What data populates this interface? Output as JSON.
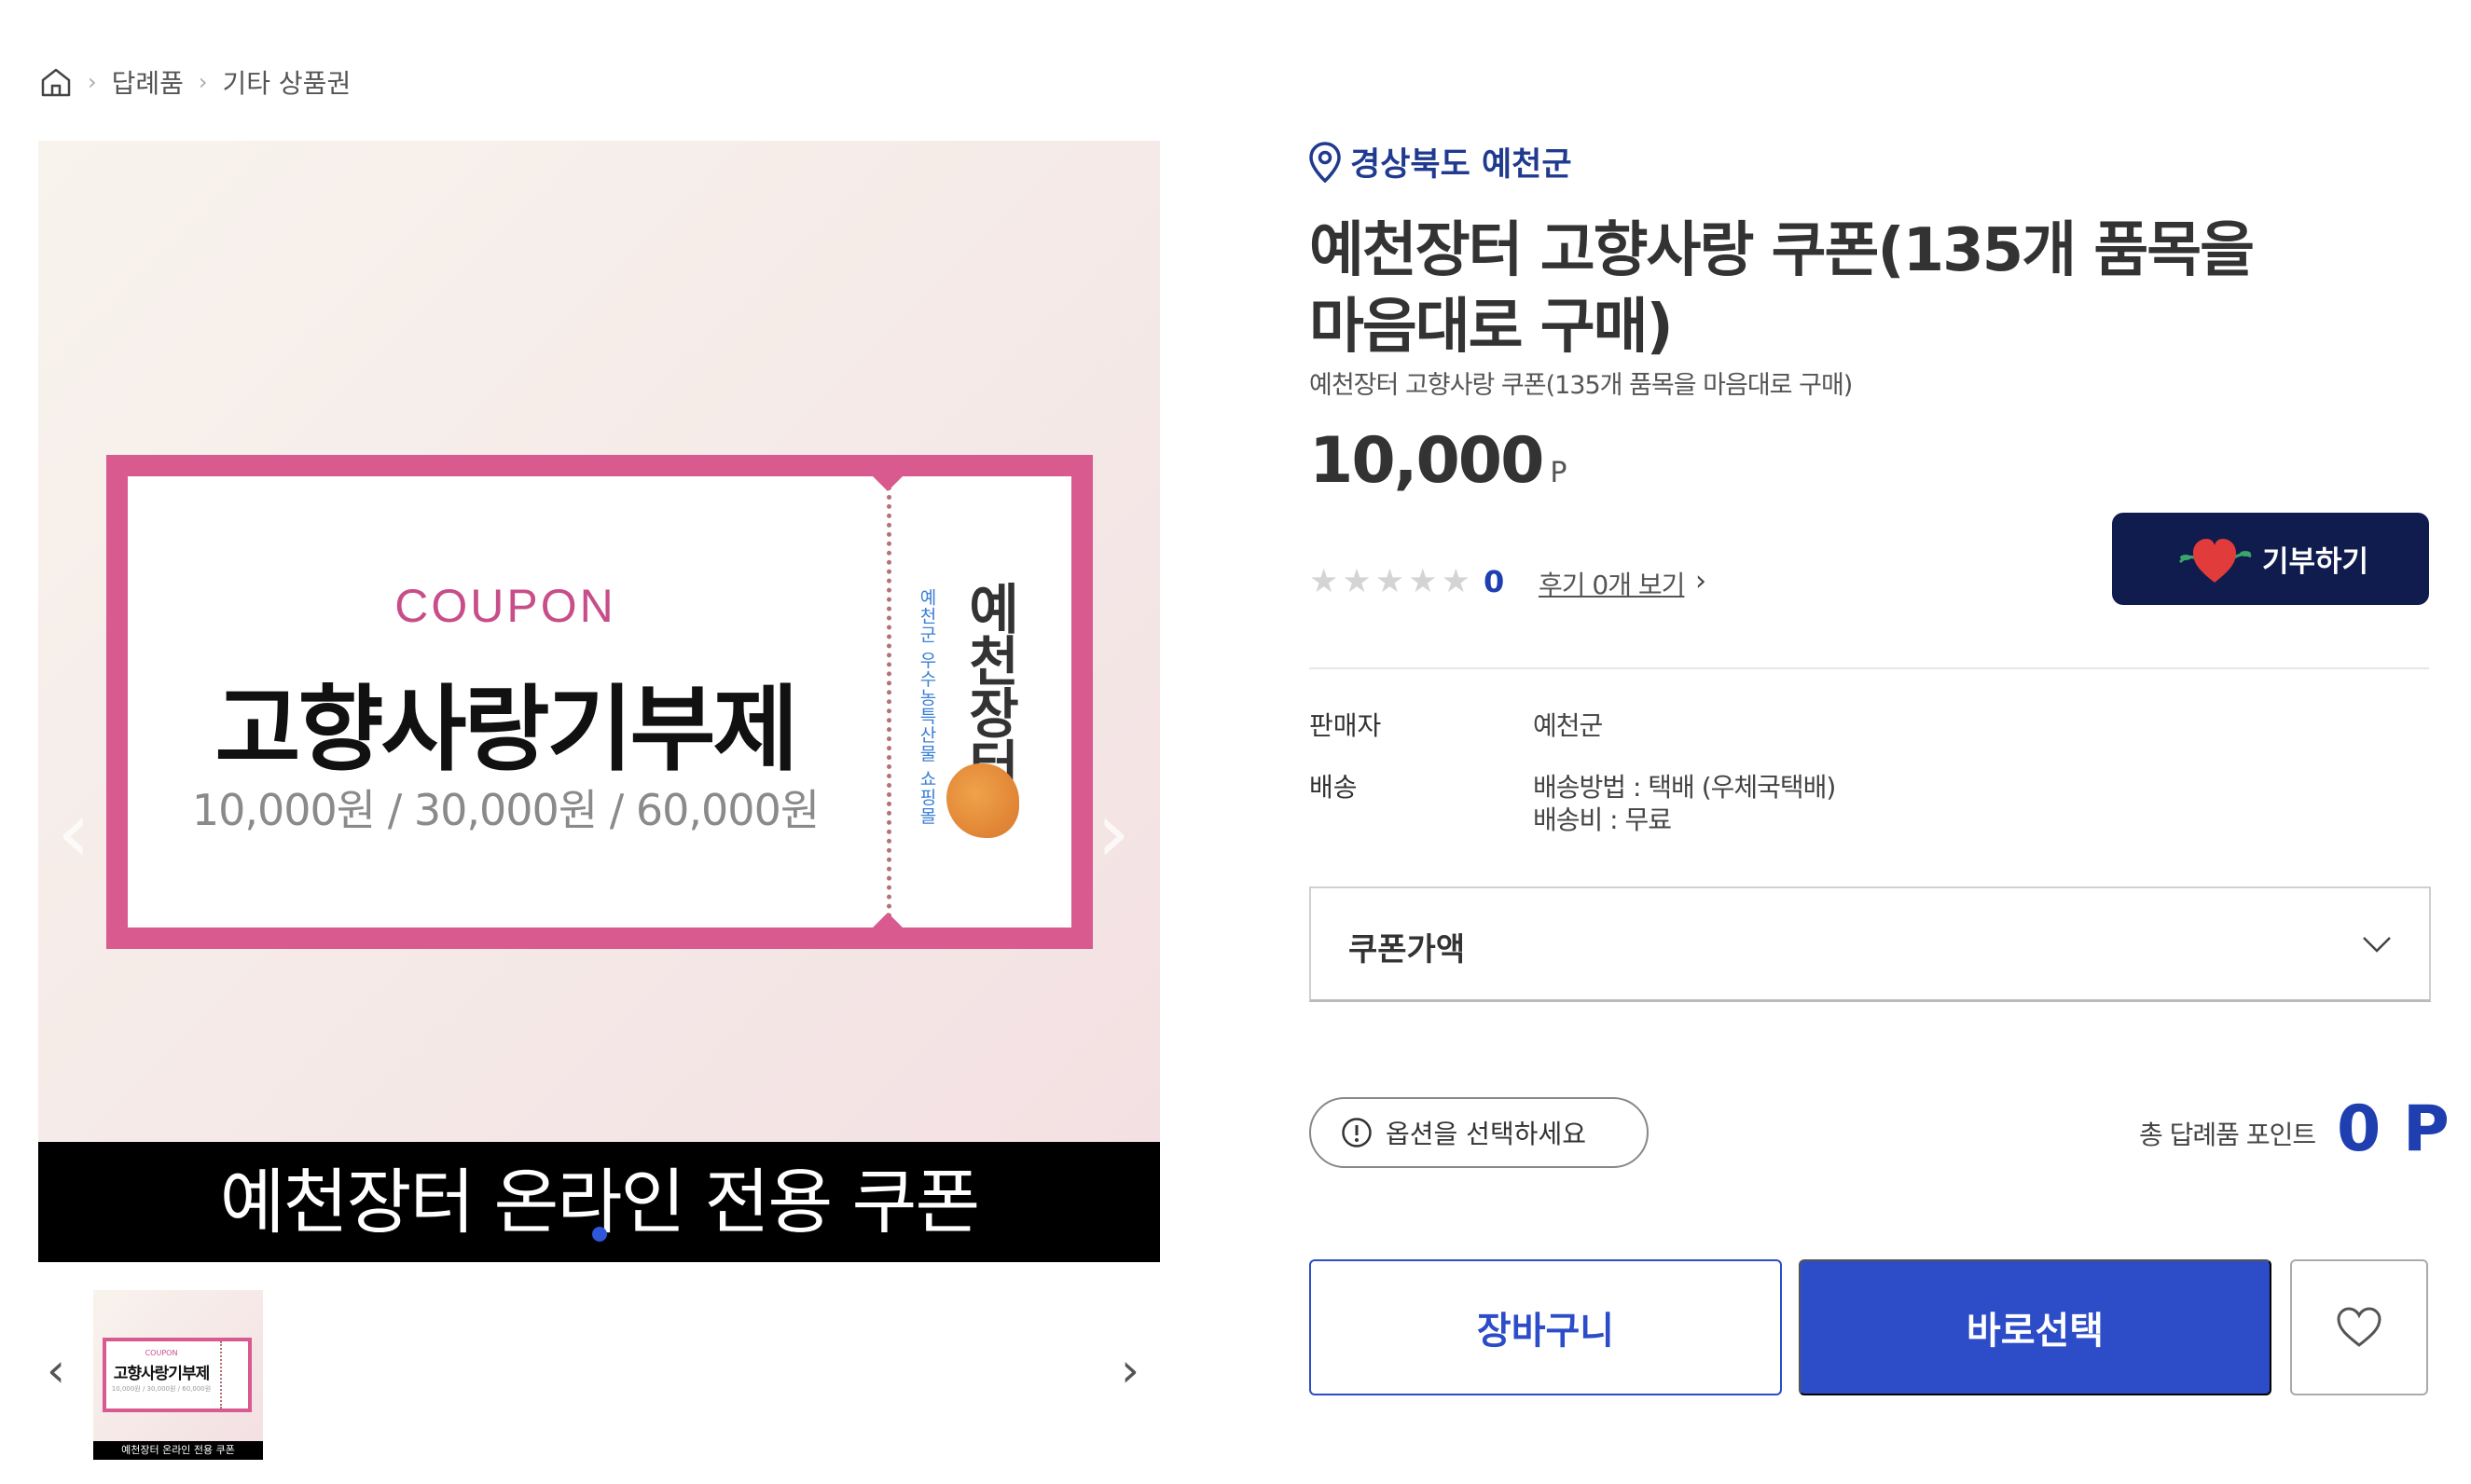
{
  "breadcrumb": {
    "home_icon": "home-icon",
    "items": [
      "답례품",
      "기타 상품권"
    ]
  },
  "gallery": {
    "main_image": {
      "coupon_word": "COUPON",
      "coupon_title": "고향사랑기부제",
      "coupon_amounts": "10,000원 / 30,000원 / 60,000원",
      "stub_sub": "예천군 우수농특산물 쇼핑몰",
      "stub_brand": "예천장터",
      "banner_text": "예천장터 온라인 전용 쿠폰"
    },
    "thumbnail": {
      "coupon_word": "COUPON",
      "coupon_title": "고향사랑기부제",
      "coupon_amounts": "10,000원 / 30,000원 / 60,000원",
      "banner_text": "예천장터 온라인 전용 쿠폰"
    },
    "colors": {
      "frame": "#d85a8e",
      "banner": "#000000"
    }
  },
  "product": {
    "region": "경상북도 예천군",
    "title": "예천장터 고향사랑 쿠폰(135개 품목을 마음대로 구매)",
    "subtitle": "예천장터 고향사랑 쿠폰(135개 품목을 마음대로 구매)",
    "price": "10,000",
    "price_unit": "P",
    "rating": {
      "stars": 5,
      "score": "0"
    },
    "review_link": "후기 0개 보기",
    "donate_button": "기부하기",
    "seller_label": "판매자",
    "seller_value": "예천군",
    "shipping_label": "배송",
    "shipping_method": "배송방법 : 택배 (우체국택배)",
    "shipping_fee": "배송비 : 무료"
  },
  "options": {
    "select_label": "쿠폰가액",
    "hint": "옵션을 선택하세요",
    "total_label": "총 답례품 포인트",
    "total_value": "0 P"
  },
  "actions": {
    "cart": "장바구니",
    "buy": "바로선택",
    "wish_icon": "heart-outline-icon"
  },
  "colors": {
    "accent": "#2c4cc8",
    "navy": "#0f1c4d",
    "region": "#1f3a8f"
  }
}
